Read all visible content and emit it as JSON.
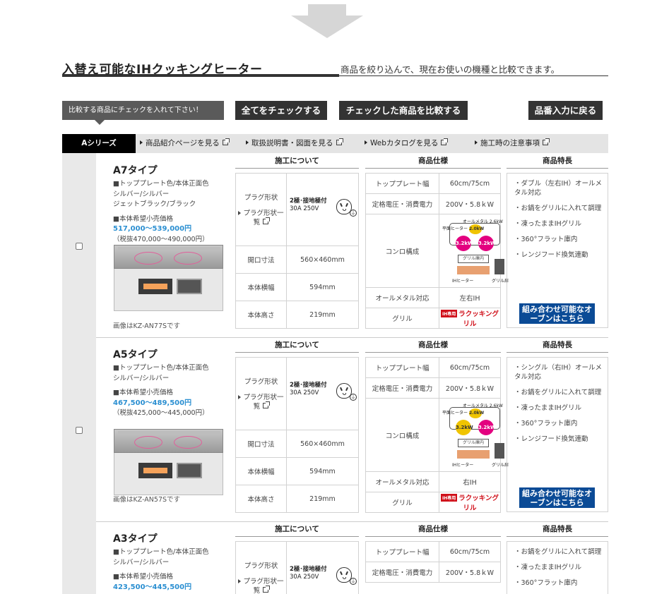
{
  "header": {
    "title": "入替え可能なIHクッキングヒーター",
    "subtitle": "商品を絞り込んで、現在お使いの機種と比較できます。"
  },
  "toolbar": {
    "tip": "比較する商品にチェックを入れて下さい！",
    "check_all": "全てをチェックする",
    "compare": "チェックした商品を比較する",
    "back": "品番入力に戻る"
  },
  "tabs": {
    "active": "Aシリーズ",
    "links": [
      "商品紹介ページを見る",
      "取扱説明書・図面を見る",
      "Webカタログを見る",
      "施工時の注意事項"
    ]
  },
  "section_headers": {
    "construction": "施工について",
    "spec": "商品仕様",
    "features": "商品特長"
  },
  "labels": {
    "plug_shape": "プラグ形状",
    "plug_list": "プラグ形状一覧",
    "plug_value_1": "2極･接地極付",
    "plug_value_2": "30A 250V",
    "opening": "開口寸法",
    "body_width": "本体横幅",
    "body_height": "本体高さ",
    "top_width": "トッププレート幅",
    "voltage": "定格電圧・消費電力",
    "konro": "コンロ構成",
    "allmetal": "オールメタル対応",
    "grill": "グリル",
    "grill_brand_tag": "IH専用",
    "grill_brand": "ラクッキングリル",
    "combo": "組み合わせ可能なオーブンはこちら",
    "color_label": "■トッププレート色/本体正面色",
    "price_label": "■本体希望小売価格",
    "konro_top_label": "平面ヒーター",
    "konro_ih_label": "IHヒーター",
    "konro_grill_label": "グリル庫内",
    "konro_grill_panel": "グリル扉"
  },
  "products": [
    {
      "name": "A7タイプ",
      "colors": [
        "シルバー/シルバー",
        "ジェットブラック/ブラック"
      ],
      "price": "517,000〜539,000円",
      "price_ex": "（税抜470,000〜490,000円）",
      "caption": "画像はKZ-AN77Sです",
      "opening": "560×460mm",
      "width": "594mm",
      "height": "219mm",
      "top_width": "60cm/75cm",
      "voltage": "200V・5.8ｋW",
      "allmetal": "左右IH",
      "konro_left": "3.2kW",
      "konro_mid": "2.0kW",
      "konro_right": "3.2kW",
      "konro_allmetal_label": "オールメタル 2.6kW",
      "features": [
        "ダブル（左右IH）オールメタル対応",
        "お鍋をグリルに入れて調理",
        "凍ったままIHグリル",
        "360°フラット庫内",
        "レンジフード換気連動"
      ]
    },
    {
      "name": "A5タイプ",
      "colors": [
        "シルバー/シルバー"
      ],
      "price": "467,500〜489,500円",
      "price_ex": "（税抜425,000〜445,000円）",
      "caption": "画像はKZ-AN57Sです",
      "opening": "560×460mm",
      "width": "594mm",
      "height": "219mm",
      "top_width": "60cm/75cm",
      "voltage": "200V・5.8ｋW",
      "allmetal": "右IH",
      "konro_left": "3.2kW",
      "konro_mid": "2.0kW",
      "konro_right": "3.2kW",
      "konro_allmetal_label": "オールメタル 2.6kW",
      "features": [
        "シングル（右IH）オールメタル対応",
        "お鍋をグリルに入れて調理",
        "凍ったままIHグリル",
        "360°フラット庫内",
        "レンジフード換気連動"
      ]
    },
    {
      "name": "A3タイプ",
      "colors": [
        "シルバー/シルバー"
      ],
      "price": "423,500〜445,500円",
      "top_width": "60cm/75cm",
      "voltage": "200V・5.8ｋW",
      "features": [
        "お鍋をグリルに入れて調理",
        "凍ったままIHグリル",
        "360°フラット庫内"
      ]
    }
  ],
  "colors": {
    "dark_button": "#333333",
    "price": "#2b8fd1",
    "combo_button": "#0b4b96",
    "konro_pink": "#e3007f"
  }
}
